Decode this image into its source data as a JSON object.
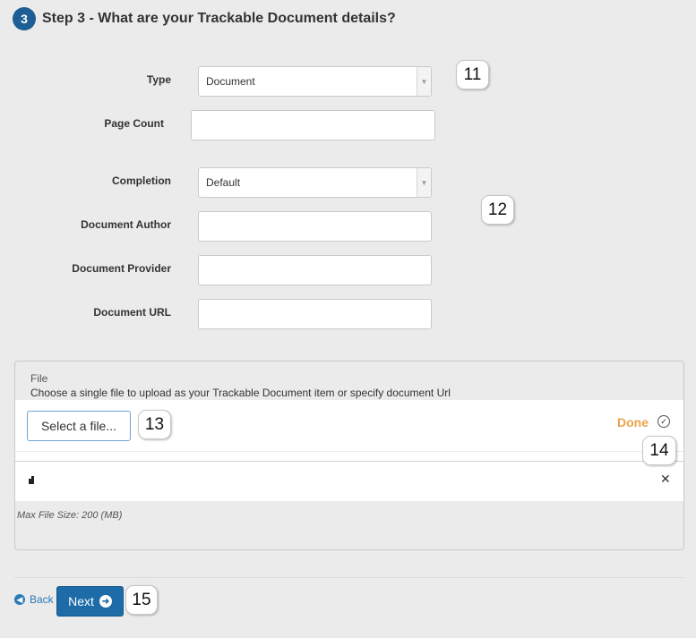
{
  "header": {
    "step_number": "3",
    "title": "Step 3 - What are your Trackable Document details?"
  },
  "form": {
    "type_label": "Type",
    "type_value": "Document",
    "page_count_label": "Page Count",
    "page_count_value": "",
    "completion_label": "Completion",
    "completion_value": "Default",
    "author_label": "Document Author",
    "author_value": "",
    "provider_label": "Document Provider",
    "provider_value": "",
    "url_label": "Document URL",
    "url_value": ""
  },
  "file_panel": {
    "title": "File",
    "description": "Choose a single file to upload as your Trackable Document item or specify document Url",
    "select_button": "Select a file...",
    "done_label": "Done",
    "max_size": "Max File Size: 200 (MB)"
  },
  "footer": {
    "back_label": "Back",
    "next_label": "Next"
  },
  "callouts": [
    "11",
    "12",
    "13",
    "14",
    "15"
  ],
  "icons": {
    "caret": "chevron-down-icon",
    "done": "check-circle-icon",
    "remove": "close-icon",
    "grip": "grip-icon",
    "back": "arrow-left-circle-icon",
    "next": "arrow-right-circle-icon"
  },
  "colors": {
    "primary": "#1e6ca7",
    "done": "#e9a44a",
    "badge": "#1d5f94"
  }
}
